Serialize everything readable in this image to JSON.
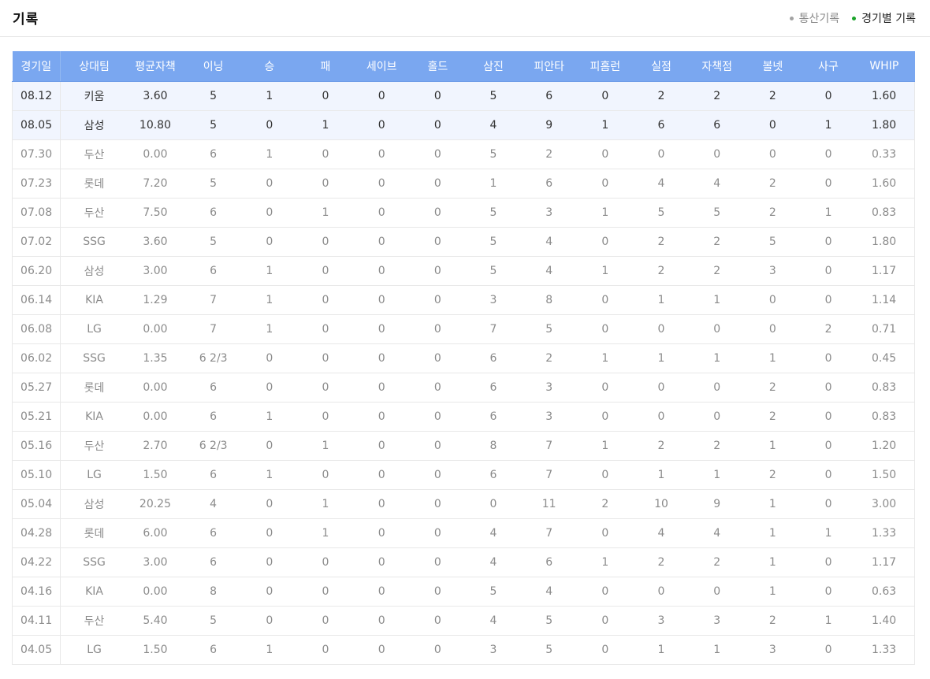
{
  "header": {
    "title": "기록",
    "tabs": [
      {
        "label": "통산기록",
        "active": false,
        "dot_color": "#a3a3a3"
      },
      {
        "label": "경기별 기록",
        "active": true,
        "dot_color": "#1aa32a"
      }
    ]
  },
  "colors": {
    "header_bg": "#7aa7f0",
    "highlight_row_bg": "#f1f5fe",
    "active_dot": "#1aa32a"
  },
  "table": {
    "columns": [
      "경기일",
      "상대팀",
      "평균자책",
      "이닝",
      "승",
      "패",
      "세이브",
      "홀드",
      "삼진",
      "피안타",
      "피홈런",
      "실점",
      "자책점",
      "볼넷",
      "사구",
      "WHIP"
    ],
    "rows": [
      {
        "highlight": true,
        "cells": [
          "08.12",
          "키움",
          "3.60",
          "5",
          "1",
          "0",
          "0",
          "0",
          "5",
          "6",
          "0",
          "2",
          "2",
          "2",
          "0",
          "1.60"
        ]
      },
      {
        "highlight": true,
        "cells": [
          "08.05",
          "삼성",
          "10.80",
          "5",
          "0",
          "1",
          "0",
          "0",
          "4",
          "9",
          "1",
          "6",
          "6",
          "0",
          "1",
          "1.80"
        ]
      },
      {
        "highlight": false,
        "cells": [
          "07.30",
          "두산",
          "0.00",
          "6",
          "1",
          "0",
          "0",
          "0",
          "5",
          "2",
          "0",
          "0",
          "0",
          "0",
          "0",
          "0.33"
        ]
      },
      {
        "highlight": false,
        "cells": [
          "07.23",
          "롯데",
          "7.20",
          "5",
          "0",
          "0",
          "0",
          "0",
          "1",
          "6",
          "0",
          "4",
          "4",
          "2",
          "0",
          "1.60"
        ]
      },
      {
        "highlight": false,
        "cells": [
          "07.08",
          "두산",
          "7.50",
          "6",
          "0",
          "1",
          "0",
          "0",
          "5",
          "3",
          "1",
          "5",
          "5",
          "2",
          "1",
          "0.83"
        ]
      },
      {
        "highlight": false,
        "cells": [
          "07.02",
          "SSG",
          "3.60",
          "5",
          "0",
          "0",
          "0",
          "0",
          "5",
          "4",
          "0",
          "2",
          "2",
          "5",
          "0",
          "1.80"
        ]
      },
      {
        "highlight": false,
        "cells": [
          "06.20",
          "삼성",
          "3.00",
          "6",
          "1",
          "0",
          "0",
          "0",
          "5",
          "4",
          "1",
          "2",
          "2",
          "3",
          "0",
          "1.17"
        ]
      },
      {
        "highlight": false,
        "cells": [
          "06.14",
          "KIA",
          "1.29",
          "7",
          "1",
          "0",
          "0",
          "0",
          "3",
          "8",
          "0",
          "1",
          "1",
          "0",
          "0",
          "1.14"
        ]
      },
      {
        "highlight": false,
        "cells": [
          "06.08",
          "LG",
          "0.00",
          "7",
          "1",
          "0",
          "0",
          "0",
          "7",
          "5",
          "0",
          "0",
          "0",
          "0",
          "2",
          "0.71"
        ]
      },
      {
        "highlight": false,
        "cells": [
          "06.02",
          "SSG",
          "1.35",
          "6 2/3",
          "0",
          "0",
          "0",
          "0",
          "6",
          "2",
          "1",
          "1",
          "1",
          "1",
          "0",
          "0.45"
        ]
      },
      {
        "highlight": false,
        "cells": [
          "05.27",
          "롯데",
          "0.00",
          "6",
          "0",
          "0",
          "0",
          "0",
          "6",
          "3",
          "0",
          "0",
          "0",
          "2",
          "0",
          "0.83"
        ]
      },
      {
        "highlight": false,
        "cells": [
          "05.21",
          "KIA",
          "0.00",
          "6",
          "1",
          "0",
          "0",
          "0",
          "6",
          "3",
          "0",
          "0",
          "0",
          "2",
          "0",
          "0.83"
        ]
      },
      {
        "highlight": false,
        "cells": [
          "05.16",
          "두산",
          "2.70",
          "6 2/3",
          "0",
          "1",
          "0",
          "0",
          "8",
          "7",
          "1",
          "2",
          "2",
          "1",
          "0",
          "1.20"
        ]
      },
      {
        "highlight": false,
        "cells": [
          "05.10",
          "LG",
          "1.50",
          "6",
          "1",
          "0",
          "0",
          "0",
          "6",
          "7",
          "0",
          "1",
          "1",
          "2",
          "0",
          "1.50"
        ]
      },
      {
        "highlight": false,
        "cells": [
          "05.04",
          "삼성",
          "20.25",
          "4",
          "0",
          "1",
          "0",
          "0",
          "0",
          "11",
          "2",
          "10",
          "9",
          "1",
          "0",
          "3.00"
        ]
      },
      {
        "highlight": false,
        "cells": [
          "04.28",
          "롯데",
          "6.00",
          "6",
          "0",
          "1",
          "0",
          "0",
          "4",
          "7",
          "0",
          "4",
          "4",
          "1",
          "1",
          "1.33"
        ]
      },
      {
        "highlight": false,
        "cells": [
          "04.22",
          "SSG",
          "3.00",
          "6",
          "0",
          "0",
          "0",
          "0",
          "4",
          "6",
          "1",
          "2",
          "2",
          "1",
          "0",
          "1.17"
        ]
      },
      {
        "highlight": false,
        "cells": [
          "04.16",
          "KIA",
          "0.00",
          "8",
          "0",
          "0",
          "0",
          "0",
          "5",
          "4",
          "0",
          "0",
          "0",
          "1",
          "0",
          "0.63"
        ]
      },
      {
        "highlight": false,
        "cells": [
          "04.11",
          "두산",
          "5.40",
          "5",
          "0",
          "0",
          "0",
          "0",
          "4",
          "5",
          "0",
          "3",
          "3",
          "2",
          "1",
          "1.40"
        ]
      },
      {
        "highlight": false,
        "cells": [
          "04.05",
          "LG",
          "1.50",
          "6",
          "1",
          "0",
          "0",
          "0",
          "3",
          "5",
          "0",
          "1",
          "1",
          "3",
          "0",
          "1.33"
        ]
      }
    ]
  }
}
